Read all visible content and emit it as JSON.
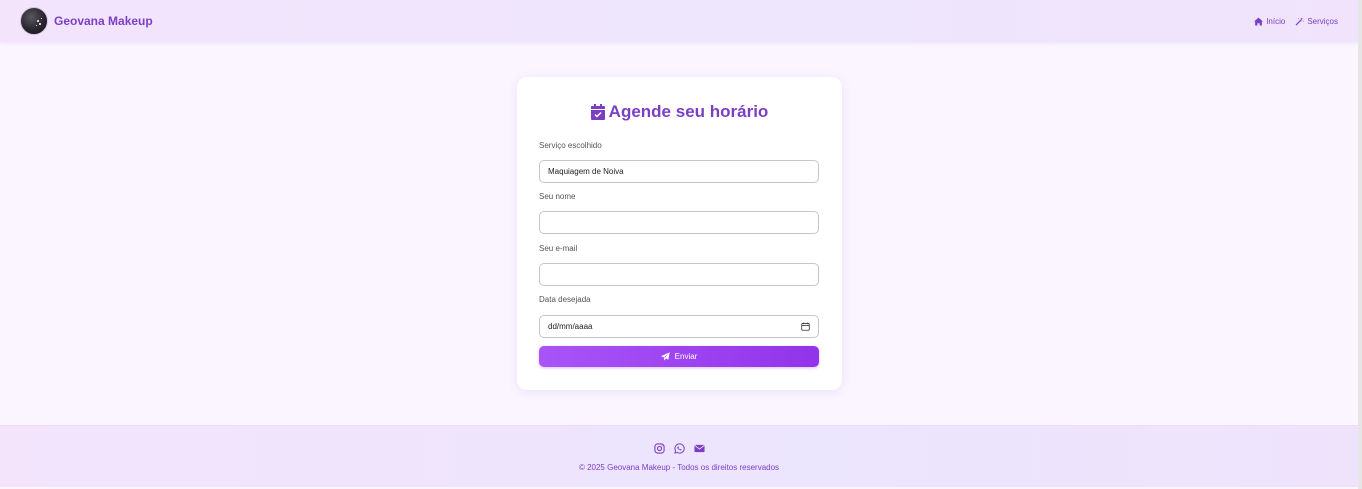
{
  "header": {
    "brand": "Geovana Makeup",
    "nav": [
      {
        "label": "Início",
        "icon": "home-icon"
      },
      {
        "label": "Serviços",
        "icon": "magic-wand-icon"
      }
    ]
  },
  "form": {
    "title": "Agende seu horário",
    "title_icon": "calendar-check-icon",
    "service_label": "Serviço escolhido",
    "service_value": "Maquiagem de Noiva",
    "name_label": "Seu nome",
    "name_value": "",
    "email_label": "Seu e-mail",
    "email_value": "",
    "date_label": "Data desejada",
    "date_value": "dd/mm/aaaa",
    "submit_label": "Enviar",
    "submit_icon": "paper-plane-icon"
  },
  "footer": {
    "social": [
      "instagram-icon",
      "whatsapp-icon",
      "envelope-icon"
    ],
    "copyright": "© 2025 Geovana Makeup - Todos os direitos reservados"
  },
  "colors": {
    "accent": "#7b3fc4",
    "button_start": "#a855f7",
    "button_end": "#9333ea",
    "background": "#faf5ff"
  }
}
